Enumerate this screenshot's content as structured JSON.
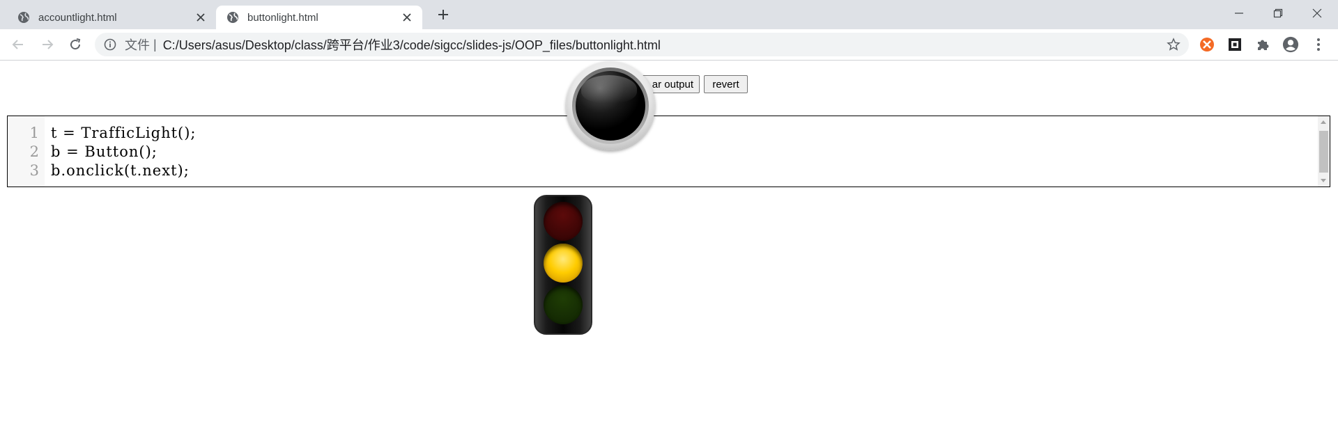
{
  "browser": {
    "tabs": [
      {
        "title": "accountlight.html",
        "active": false
      },
      {
        "title": "buttonlight.html",
        "active": true
      }
    ],
    "address": {
      "security_label": "文件",
      "url": "C:/Users/asus/Desktop/class/跨平台/作业3/code/sigcc/slides-js/OOP_files/buttonlight.html"
    },
    "icons": {
      "back": "arrow-left-icon",
      "forward": "arrow-right-icon",
      "reload": "reload-icon",
      "info": "info-icon",
      "bookmark": "star-icon",
      "extensions": [
        "orange-extension-icon",
        "square-extension-icon",
        "puzzle-icon",
        "profile-icon",
        "menu-icon"
      ]
    }
  },
  "page": {
    "buttons": {
      "clear_output": "clear output",
      "clear_output_visible": "ar output",
      "revert": "revert"
    },
    "editor": {
      "line_numbers": [
        "1",
        "2",
        "3"
      ],
      "lines": [
        "t = TrafficLight();",
        "b = Button();",
        "b.onclick(t.next);"
      ]
    },
    "traffic_light": {
      "state": "yellow",
      "colors": {
        "red_off": "#5c0a0a",
        "yellow_on": "#ffcc00",
        "green_off": "#1f3d05"
      }
    },
    "round_button": {
      "state": "released"
    }
  }
}
